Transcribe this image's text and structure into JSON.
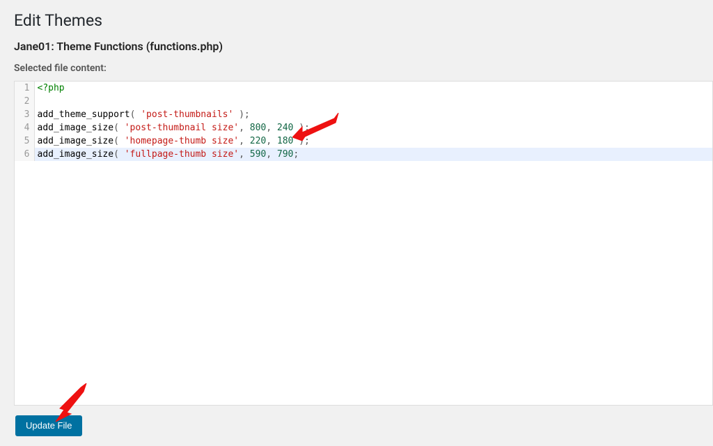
{
  "header": {
    "title": "Edit Themes",
    "file_heading": "Jane01: Theme Functions (functions.php)",
    "selected_label": "Selected file content:"
  },
  "buttons": {
    "update_file": "Update File"
  },
  "editor": {
    "highlight_line": 6,
    "lines": [
      {
        "n": 1,
        "tokens": [
          {
            "t": "<?php",
            "c": "tag"
          }
        ]
      },
      {
        "n": 2,
        "tokens": []
      },
      {
        "n": 3,
        "tokens": [
          {
            "t": "add_theme_support",
            "c": "fn"
          },
          {
            "t": "( ",
            "c": "punc"
          },
          {
            "t": "'post-thumbnails'",
            "c": "str"
          },
          {
            "t": " );",
            "c": "punc"
          }
        ]
      },
      {
        "n": 4,
        "tokens": [
          {
            "t": "add_image_size",
            "c": "fn"
          },
          {
            "t": "( ",
            "c": "punc"
          },
          {
            "t": "'post-thumbnail size'",
            "c": "str"
          },
          {
            "t": ", ",
            "c": "punc"
          },
          {
            "t": "800",
            "c": "num"
          },
          {
            "t": ", ",
            "c": "punc"
          },
          {
            "t": "240",
            "c": "num"
          },
          {
            "t": " );",
            "c": "punc"
          }
        ]
      },
      {
        "n": 5,
        "tokens": [
          {
            "t": "add_image_size",
            "c": "fn"
          },
          {
            "t": "( ",
            "c": "punc"
          },
          {
            "t": "'homepage-thumb size'",
            "c": "str"
          },
          {
            "t": ", ",
            "c": "punc"
          },
          {
            "t": "220",
            "c": "num"
          },
          {
            "t": ", ",
            "c": "punc"
          },
          {
            "t": "180",
            "c": "num"
          },
          {
            "t": " );",
            "c": "punc"
          }
        ]
      },
      {
        "n": 6,
        "tokens": [
          {
            "t": "add_image_size",
            "c": "fn"
          },
          {
            "t": "( ",
            "c": "punc"
          },
          {
            "t": "'fullpage-thumb size'",
            "c": "str"
          },
          {
            "t": ", ",
            "c": "punc"
          },
          {
            "t": "590",
            "c": "num"
          },
          {
            "t": ", ",
            "c": "punc"
          },
          {
            "t": "790",
            "c": "num"
          },
          {
            "t": ";",
            "c": "punc"
          }
        ]
      }
    ]
  }
}
